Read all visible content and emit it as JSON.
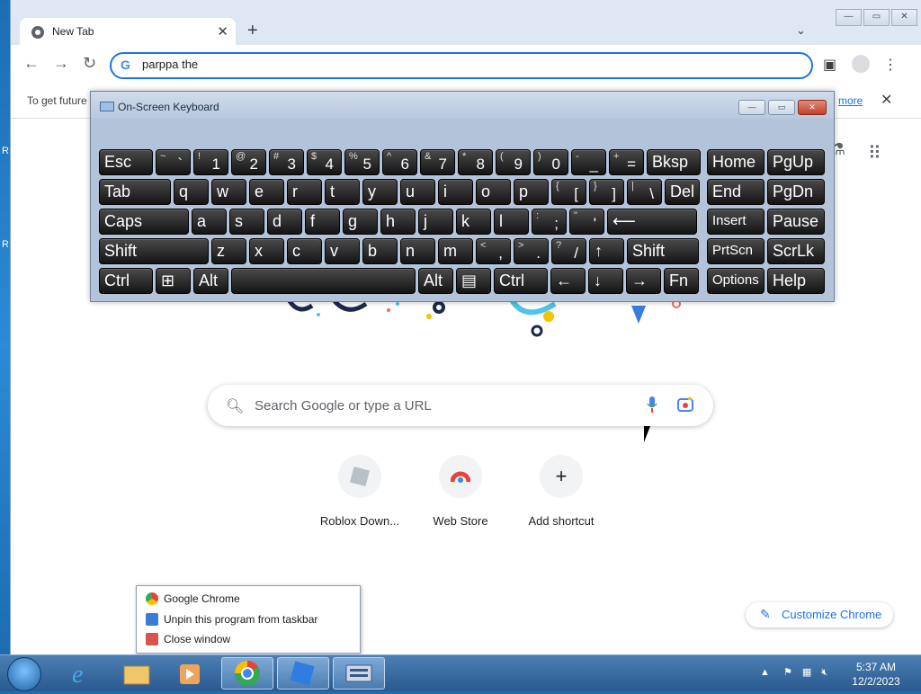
{
  "browser": {
    "tab_title": "New Tab",
    "omnibox_text": "parppa the",
    "infobar_text": "To get future",
    "infobar_link": "more"
  },
  "ntp": {
    "search_placeholder": "Search Google or type a URL",
    "shortcuts": [
      "Roblox Down...",
      "Web Store",
      "Add shortcut"
    ],
    "customize_label": "Customize Chrome"
  },
  "osk": {
    "title": "On-Screen Keyboard",
    "rows": [
      [
        {
          "l": "Esc"
        },
        {
          "s": "~",
          "m": "`"
        },
        {
          "s": "!",
          "m": "1"
        },
        {
          "s": "@",
          "m": "2"
        },
        {
          "s": "#",
          "m": "3"
        },
        {
          "s": "$",
          "m": "4"
        },
        {
          "s": "%",
          "m": "5"
        },
        {
          "s": "^",
          "m": "6"
        },
        {
          "s": "&",
          "m": "7"
        },
        {
          "s": "*",
          "m": "8"
        },
        {
          "s": "(",
          "m": "9"
        },
        {
          "s": ")",
          "m": "0"
        },
        {
          "s": "-",
          "m": "_"
        },
        {
          "s": "+",
          "m": "="
        },
        {
          "l": "Bksp"
        },
        {
          "l": "Home"
        },
        {
          "l": "PgUp"
        }
      ],
      [
        {
          "l": "Tab"
        },
        {
          "l": "q"
        },
        {
          "l": "w"
        },
        {
          "l": "e"
        },
        {
          "l": "r"
        },
        {
          "l": "t"
        },
        {
          "l": "y"
        },
        {
          "l": "u"
        },
        {
          "l": "i"
        },
        {
          "l": "o"
        },
        {
          "l": "p"
        },
        {
          "s": "{",
          "m": "["
        },
        {
          "s": "}",
          "m": "]"
        },
        {
          "s": "|",
          "m": "\\"
        },
        {
          "l": "Del"
        },
        {
          "l": "End"
        },
        {
          "l": "PgDn"
        }
      ],
      [
        {
          "l": "Caps"
        },
        {
          "l": "a"
        },
        {
          "l": "s"
        },
        {
          "l": "d"
        },
        {
          "l": "f"
        },
        {
          "l": "g"
        },
        {
          "l": "h"
        },
        {
          "l": "j"
        },
        {
          "l": "k"
        },
        {
          "l": "l"
        },
        {
          "s": ":",
          "m": ";"
        },
        {
          "s": "\"",
          "m": "'"
        },
        {
          "l": "⟵"
        },
        {
          "l": "Insert"
        },
        {
          "l": "Pause"
        }
      ],
      [
        {
          "l": "Shift"
        },
        {
          "l": "z"
        },
        {
          "l": "x"
        },
        {
          "l": "c"
        },
        {
          "l": "v"
        },
        {
          "l": "b"
        },
        {
          "l": "n"
        },
        {
          "l": "m"
        },
        {
          "s": "<",
          "m": ","
        },
        {
          "s": ">",
          "m": "."
        },
        {
          "s": "?",
          "m": "/"
        },
        {
          "l": "↑"
        },
        {
          "l": "Shift"
        },
        {
          "l": "PrtScn"
        },
        {
          "l": "ScrLk"
        }
      ],
      [
        {
          "l": "Ctrl"
        },
        {
          "l": "⊞"
        },
        {
          "l": "Alt"
        },
        {
          "l": ""
        },
        {
          "l": "Alt"
        },
        {
          "l": "▤"
        },
        {
          "l": "Ctrl"
        },
        {
          "l": "←"
        },
        {
          "l": "↓"
        },
        {
          "l": "→"
        },
        {
          "l": "Fn"
        },
        {
          "l": "Options"
        },
        {
          "l": "Help"
        }
      ]
    ]
  },
  "jumplist": {
    "items": [
      "Google Chrome",
      "Unpin this program from taskbar",
      "Close window"
    ]
  },
  "taskbar": {
    "time": "5:37 AM",
    "date": "12/2/2023"
  }
}
